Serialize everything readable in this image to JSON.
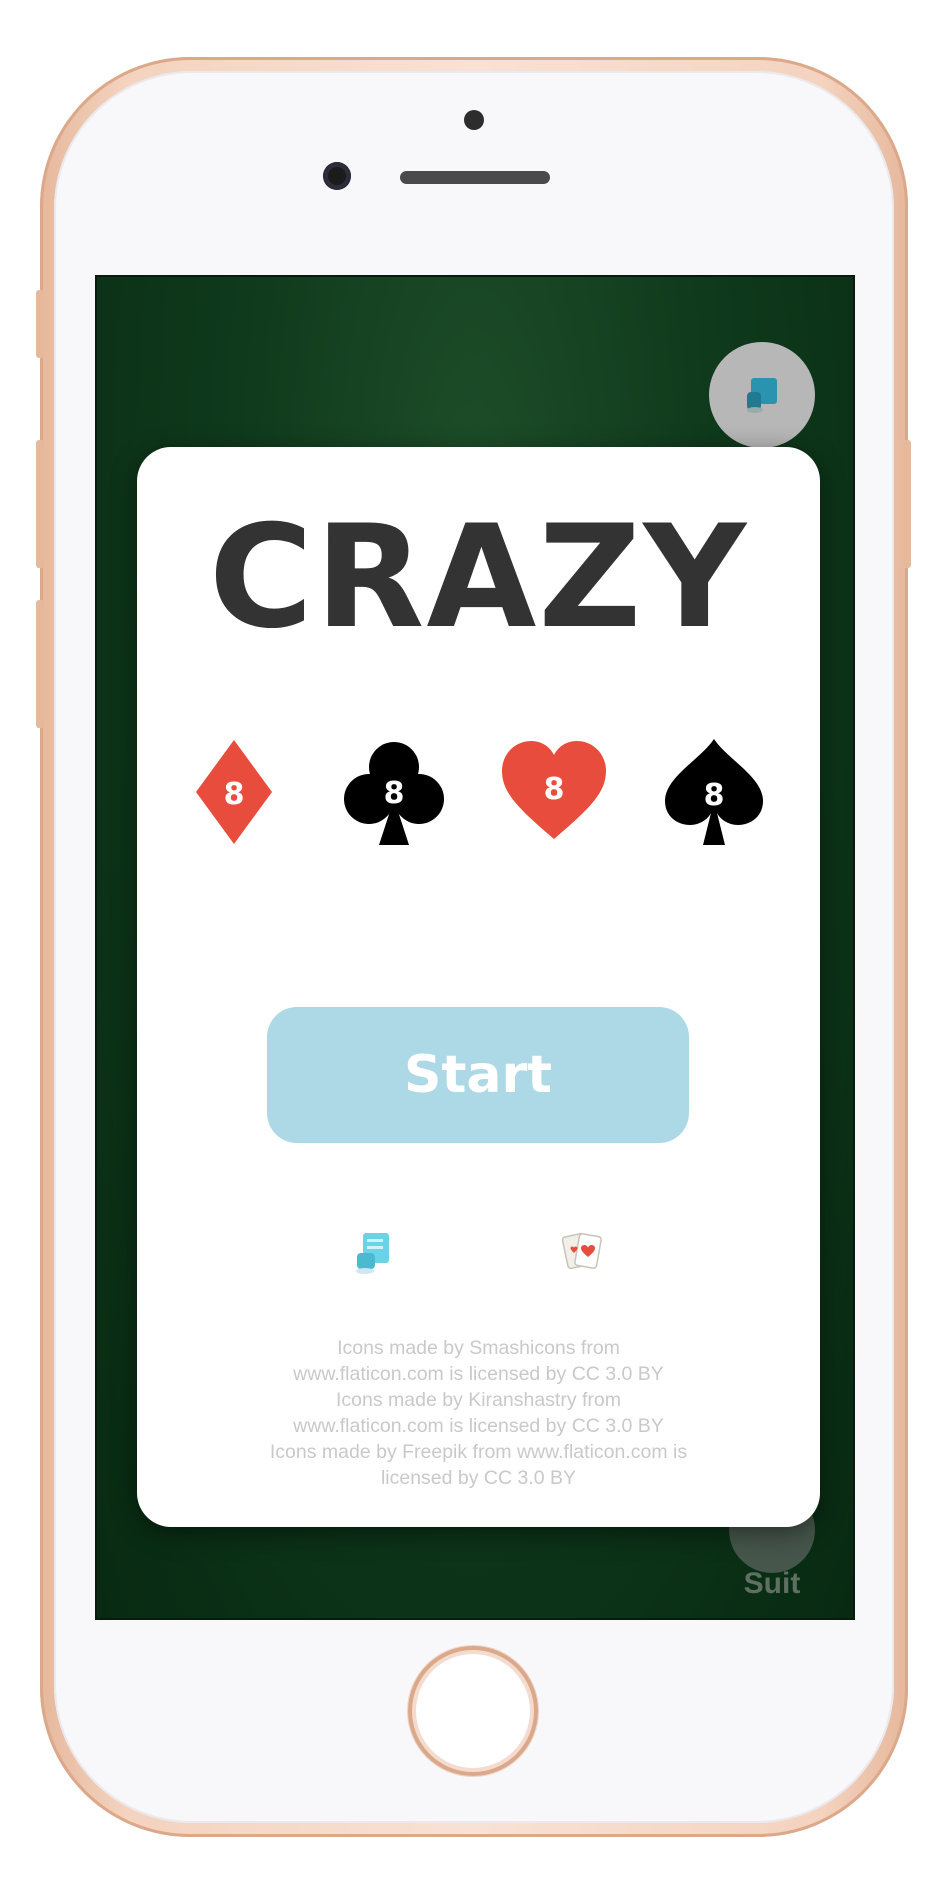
{
  "device": {
    "model": "phone",
    "color": "#f4d3bf"
  },
  "screen": {
    "background": "#0f3a1c",
    "top_button": {
      "icon": "scroll-icon"
    },
    "bottom_button": {
      "label": "Suit"
    }
  },
  "card": {
    "title": "CRAZY",
    "suits": [
      {
        "name": "diamond",
        "rank": "8",
        "color": "#e74c3c"
      },
      {
        "name": "club",
        "rank": "8",
        "color": "#000000"
      },
      {
        "name": "heart",
        "rank": "8",
        "color": "#e74c3c"
      },
      {
        "name": "spade",
        "rank": "8",
        "color": "#000000"
      }
    ],
    "start_button": {
      "label": "Start",
      "color": "#add8e6"
    },
    "icons": {
      "left": "scroll-icon",
      "right": "playing-cards-icon"
    },
    "credits": [
      "Icons made by Smashicons from",
      "www.flaticon.com is licensed by CC 3.0 BY",
      "Icons made by Kiranshastry from",
      "www.flaticon.com is licensed by CC 3.0 BY",
      "Icons made by Freepik from www.flaticon.com is",
      "licensed by CC 3.0 BY"
    ]
  }
}
